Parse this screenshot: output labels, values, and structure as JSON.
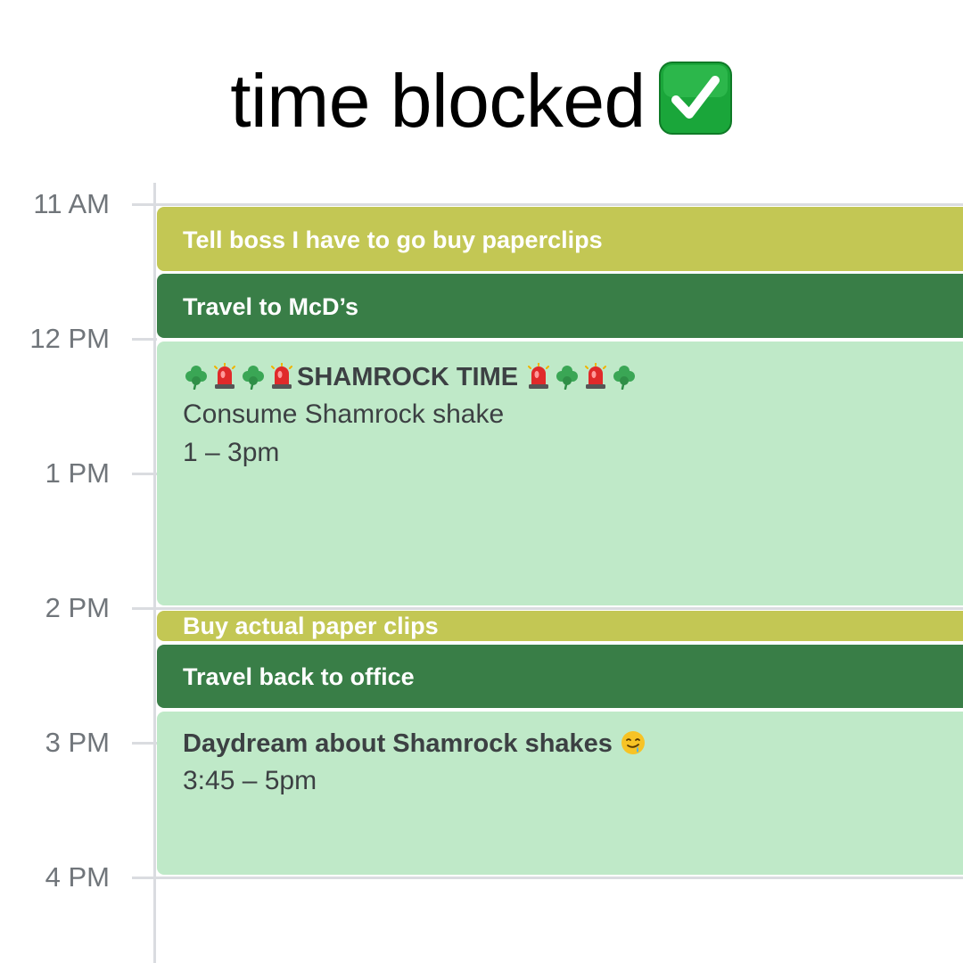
{
  "header": {
    "title": "time blocked",
    "title_icon": "check-mark-button-icon",
    "title_icon_color": "#1aa63a"
  },
  "timeline": {
    "hours": [
      "11 AM",
      "12 PM",
      "1 PM",
      "2 PM",
      "3 PM",
      "4 PM"
    ]
  },
  "colors": {
    "olive": "#c3c754",
    "dark_green": "#397e47",
    "light_green": "#bfe9c8"
  },
  "events": [
    {
      "title": "Tell boss I have to go buy paperclips",
      "color": "olive"
    },
    {
      "title": "Travel to McD’s",
      "color": "dark_green"
    },
    {
      "title": "SHAMROCK TIME",
      "title_icons": [
        "shamrock-icon",
        "siren-icon"
      ],
      "description": "Consume Shamrock shake",
      "time": "1 – 3pm",
      "color": "light_green"
    },
    {
      "title": "Buy actual paper clips",
      "color": "olive"
    },
    {
      "title": "Travel back to office",
      "color": "dark_green"
    },
    {
      "title": "Daydream about Shamrock shakes",
      "title_icon": "drooling-face-icon",
      "time": "3:45 – 5pm",
      "color": "light_green"
    }
  ]
}
